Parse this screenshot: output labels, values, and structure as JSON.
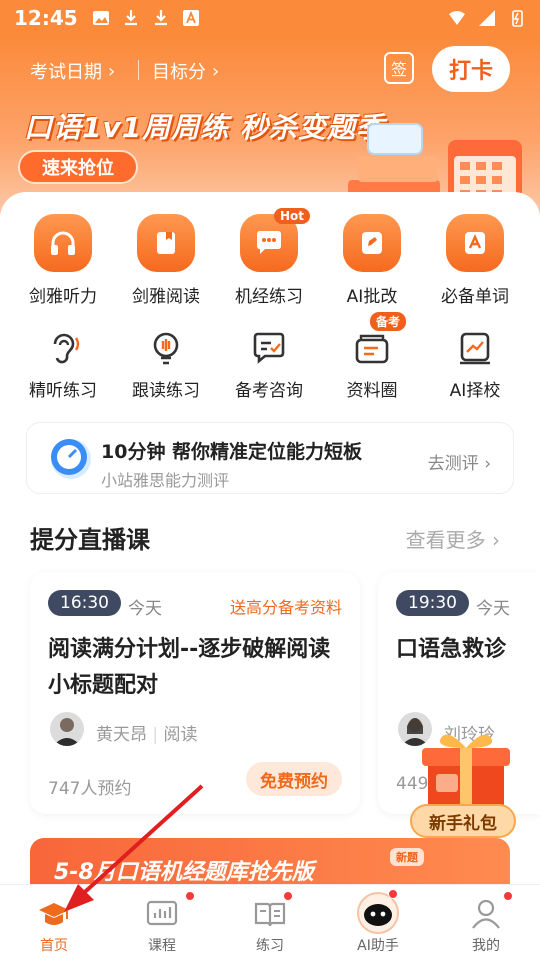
{
  "status_bar": {
    "time": "12:45"
  },
  "header": {
    "exam_date_label": "考试日期",
    "target_score_label": "目标分",
    "sign_label": "签",
    "checkin_label": "打卡",
    "banner_title": "口语1v1周周练 秒杀变题季",
    "banner_button": "速来抢位"
  },
  "grid": {
    "row1": [
      {
        "label": "剑雅听力",
        "icon": "headphones-icon"
      },
      {
        "label": "剑雅阅读",
        "icon": "book-icon"
      },
      {
        "label": "机经练习",
        "icon": "chat-icon",
        "badge": "Hot"
      },
      {
        "label": "AI批改",
        "icon": "edit-icon"
      },
      {
        "label": "必备单词",
        "icon": "vocab-icon"
      }
    ],
    "row2": [
      {
        "label": "精听练习",
        "icon": "ear-icon"
      },
      {
        "label": "跟读练习",
        "icon": "mic-icon"
      },
      {
        "label": "备考咨询",
        "icon": "consult-icon"
      },
      {
        "label": "资料圈",
        "icon": "material-icon",
        "badge": "备考"
      },
      {
        "label": "AI择校",
        "icon": "school-icon"
      }
    ]
  },
  "assessment": {
    "title": "10分钟 帮你精准定位能力短板",
    "subtitle": "小站雅思能力测评",
    "link": "去测评"
  },
  "live_section": {
    "title": "提分直播课",
    "more": "查看更多"
  },
  "courses": [
    {
      "time": "16:30",
      "day": "今天",
      "promo": "送高分备考资料",
      "title": "阅读满分计划--逐步破解阅读小标题配对",
      "teacher": "黄天昂",
      "subject": "阅读",
      "count": "747人预约",
      "reserve": "免费预约"
    },
    {
      "time": "19:30",
      "day": "今天",
      "title": "口语急救诊",
      "teacher": "刘玲玲",
      "count": "449"
    }
  ],
  "gift": {
    "label": "新手礼包"
  },
  "promo_banner": {
    "text": "5-8月口语机经题库抢先版",
    "tag": "新题"
  },
  "tabbar": [
    {
      "label": "首页",
      "active": true
    },
    {
      "label": "课程",
      "dot": true
    },
    {
      "label": "练习",
      "dot": true
    },
    {
      "label": "AI助手",
      "dot": true
    },
    {
      "label": "我的",
      "dot": true
    }
  ],
  "colors": {
    "accent": "#f06a1c",
    "header": "#fb8a3a",
    "dot": "#f43a3a"
  }
}
